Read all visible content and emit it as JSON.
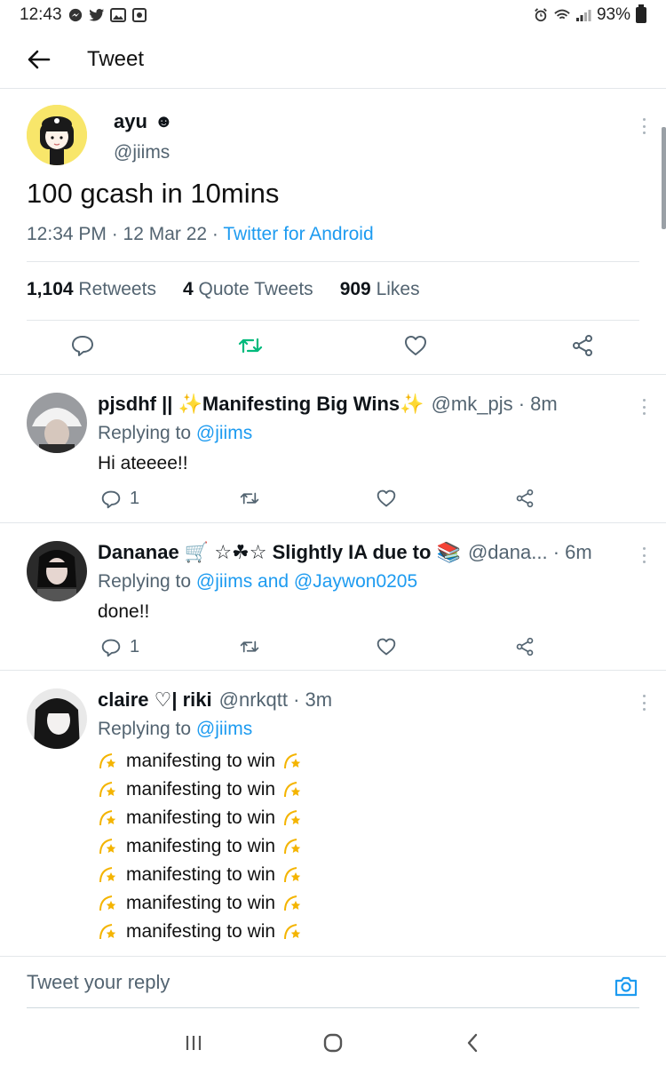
{
  "status_bar": {
    "time": "12:43",
    "battery": "93%",
    "left_icons": [
      "messenger-icon",
      "twitter-icon",
      "gallery-icon",
      "record-icon"
    ],
    "right_icons": [
      "alarm-icon",
      "wifi-icon",
      "signal-icon",
      "battery-icon"
    ]
  },
  "header": {
    "title": "Tweet",
    "back_icon": "arrow-left-icon"
  },
  "main_tweet": {
    "name": "ayu",
    "name_emoji": "☻",
    "handle": "@jiims",
    "text": "100 gcash in 10mins",
    "time": "12:34 PM · 12 Mar 22 · ",
    "source": "Twitter for Android",
    "stats": {
      "retweets_count": "1,104",
      "retweets_label": "Retweets",
      "quotes_count": "4",
      "quotes_label": "Quote Tweets",
      "likes_count": "909",
      "likes_label": "Likes"
    },
    "retweet_color": "#00ba7c"
  },
  "replies": [
    {
      "name": "pjsdhf || ✨Manifesting Big Wins✨",
      "meta": "@mk_pjs · 8m",
      "replying_prefix": "Replying to ",
      "replying_to": "@jiims",
      "text": "Hi ateeee!!",
      "reply_count": "1"
    },
    {
      "name": "Dananae 🛒 ☆☘☆ Slightly IA due to 📚",
      "meta": "@dana... · 6m",
      "replying_prefix": "Replying to ",
      "replying_to": "@jiims and @Jaywon0205",
      "text": "done!!",
      "reply_count": "1"
    },
    {
      "name": "claire ♡| riki",
      "meta": "@nrkqtt · 3m",
      "replying_prefix": "Replying to ",
      "replying_to": "@jiims",
      "lines": [
        "manifesting to win",
        "manifesting to win",
        "manifesting to win",
        "manifesting to win",
        "manifesting to win",
        "manifesting to win",
        "manifesting to win"
      ]
    }
  ],
  "reply_box": {
    "placeholder": "Tweet your reply"
  },
  "colors": {
    "link": "#1d9bf0",
    "muted": "#536471",
    "star": "#f4b400"
  }
}
